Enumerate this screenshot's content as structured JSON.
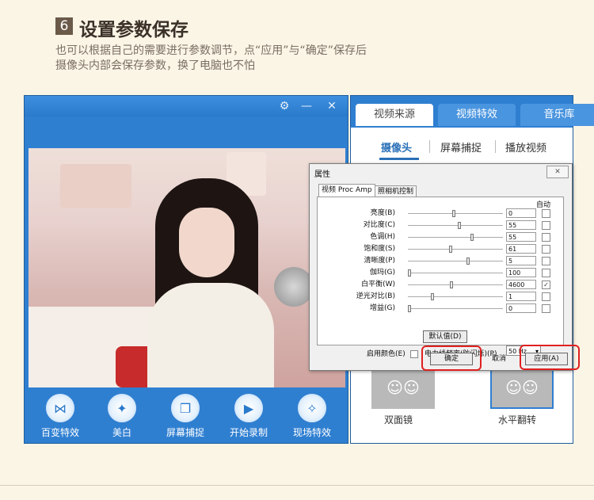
{
  "header": {
    "step_number": "6",
    "title": "设置参数保存",
    "desc_line1": "也可以根据自己的需要进行参数调节，点“应用”与“确定”保存后",
    "desc_line2": "摄像头内部会保存参数，换了电脑也不怕"
  },
  "camera_window": {
    "titlebar_icons": [
      "gear-icon",
      "minimize-icon",
      "close-icon"
    ],
    "titlebar_glyphs": {
      "settings": "⚙",
      "minimize": "—",
      "close": "✕"
    },
    "tools": [
      {
        "label": "百变特效",
        "icon": "bow-icon",
        "glyph": "⋈"
      },
      {
        "label": "美白",
        "icon": "sparkle-icon",
        "glyph": "✦"
      },
      {
        "label": "屏幕捕捉",
        "icon": "screen-capture-icon",
        "glyph": "❐"
      },
      {
        "label": "开始录制",
        "icon": "record-video-icon",
        "glyph": "▶"
      },
      {
        "label": "现场特效",
        "icon": "magic-wand-icon",
        "glyph": "✧"
      }
    ]
  },
  "right_panel": {
    "tabs": [
      "视频来源",
      "视频特效",
      "音乐库"
    ],
    "active_tab": "视频来源",
    "sub_tabs": [
      "摄像头",
      "屏幕捕捉",
      "播放视频"
    ],
    "effects": [
      {
        "label": "双面镜"
      },
      {
        "label": "水平翻转"
      }
    ]
  },
  "dialog": {
    "title": "属性",
    "close_glyph": "✕",
    "tabs": [
      "视频 Proc Amp",
      "照相机控制"
    ],
    "auto_header": "自动",
    "properties": [
      {
        "label": "亮度(B)",
        "value": "0",
        "level": 0.48,
        "auto": false
      },
      {
        "label": "对比度(C)",
        "value": "55",
        "level": 0.54,
        "auto": false
      },
      {
        "label": "色调(H)",
        "value": "55",
        "level": 0.68,
        "auto": false
      },
      {
        "label": "饱和度(S)",
        "value": "61",
        "level": 0.45,
        "auto": false
      },
      {
        "label": "清晰度(P)",
        "value": "5",
        "level": 0.64,
        "auto": false
      },
      {
        "label": "伽玛(G)",
        "value": "100",
        "level": 0.0,
        "auto": false
      },
      {
        "label": "白平衡(W)",
        "value": "4600",
        "level": 0.46,
        "auto": true
      },
      {
        "label": "逆光对比(B)",
        "value": "1",
        "level": 0.25,
        "auto": false
      },
      {
        "label": "增益(G)",
        "value": "0",
        "level": 0.0,
        "auto": false
      }
    ],
    "enable_color_label": "启用颜色(E)",
    "powerline_label": "电力线频率(防闪烁)(P)",
    "powerline_value": "50 Hz",
    "default_button": "默认值(D)",
    "ok_button": "确定",
    "cancel_button": "取消",
    "apply_button": "应用(A)",
    "highlight_color": "#e02020"
  }
}
